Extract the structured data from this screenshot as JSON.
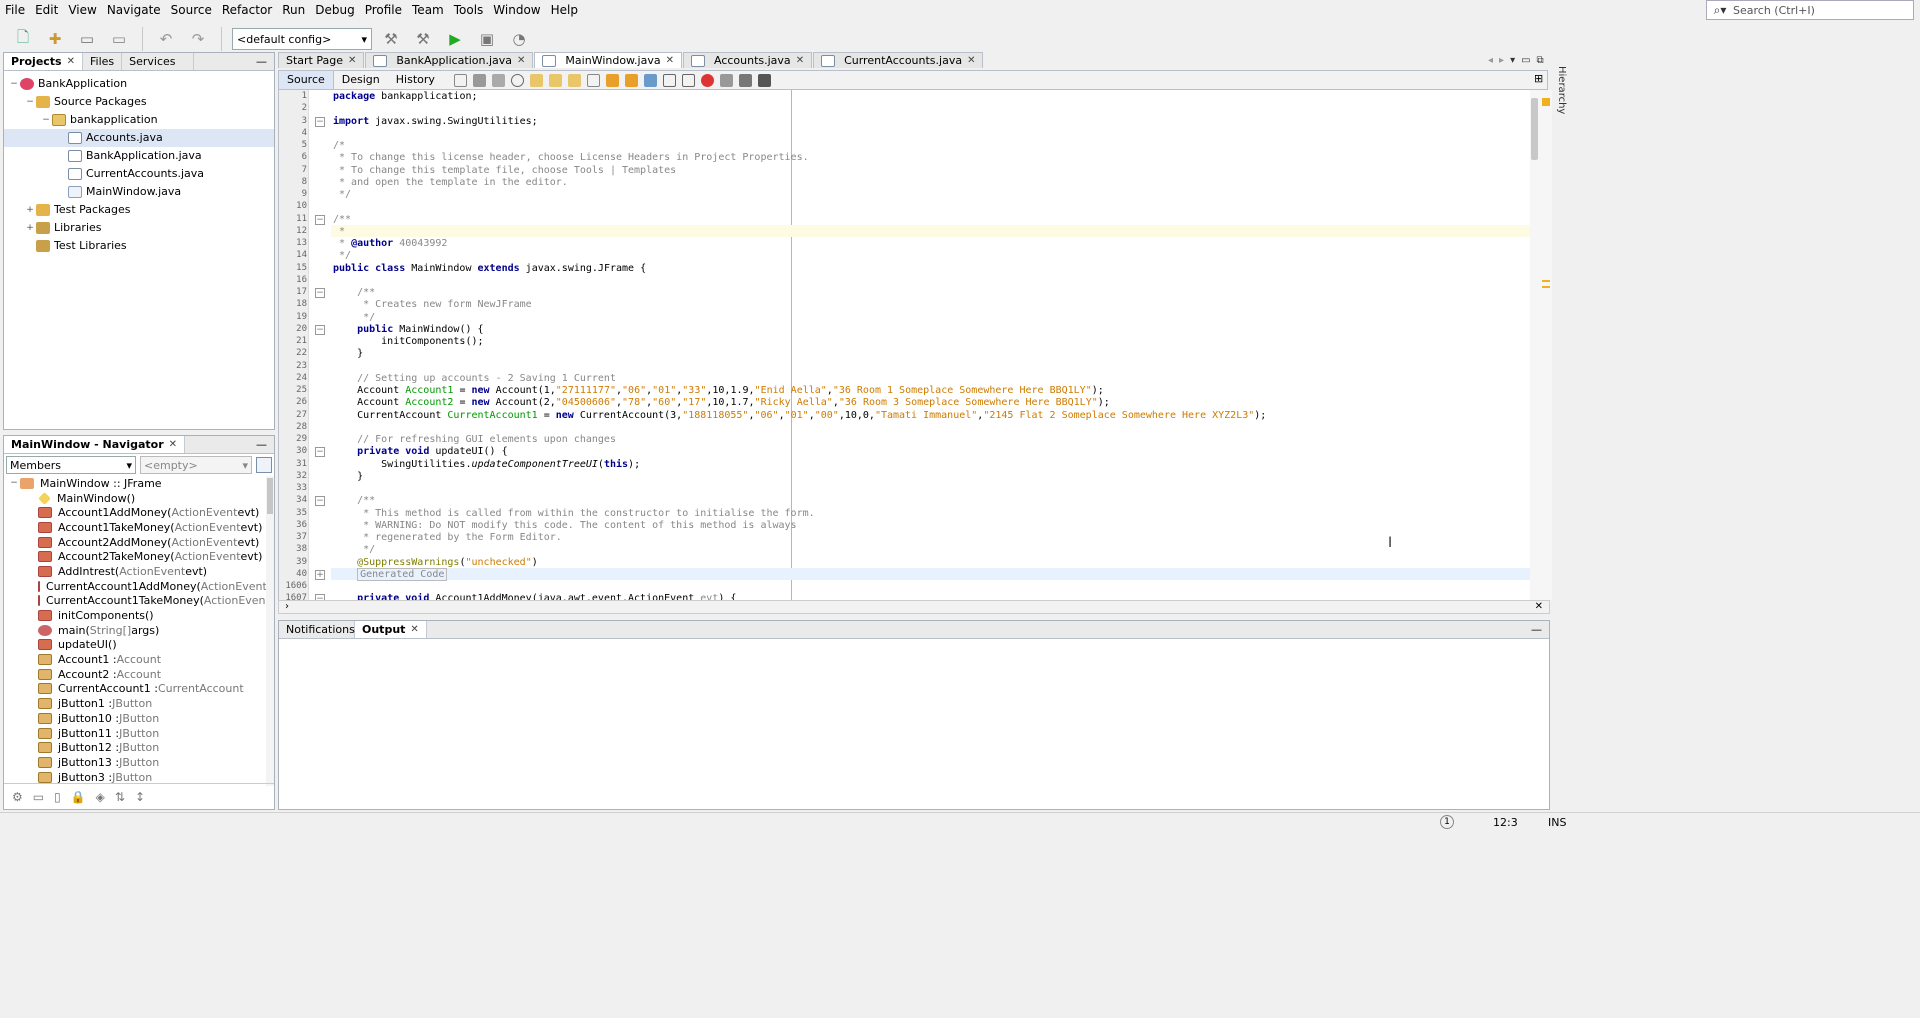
{
  "menubar": [
    "File",
    "Edit",
    "View",
    "Navigate",
    "Source",
    "Refactor",
    "Run",
    "Debug",
    "Profile",
    "Team",
    "Tools",
    "Window",
    "Help"
  ],
  "search": {
    "placeholder": "Search (Ctrl+I)",
    "icon": "search-icon"
  },
  "toolbar": {
    "config": "<default config>"
  },
  "projects": {
    "tabs": [
      "Projects",
      "Files",
      "Services"
    ],
    "tree": [
      {
        "label": "BankApplication",
        "icon": "project-icon",
        "depth": 0,
        "toggle": "−"
      },
      {
        "label": "Source Packages",
        "icon": "folder-icon",
        "depth": 1,
        "toggle": "−"
      },
      {
        "label": "bankapplication",
        "icon": "package-icon",
        "depth": 2,
        "toggle": "−"
      },
      {
        "label": "Accounts.java",
        "icon": "java-file-icon",
        "depth": 3,
        "toggle": "",
        "selected": true
      },
      {
        "label": "BankApplication.java",
        "icon": "java-file-icon",
        "depth": 3,
        "toggle": ""
      },
      {
        "label": "CurrentAccounts.java",
        "icon": "java-file-icon",
        "depth": 3,
        "toggle": ""
      },
      {
        "label": "MainWindow.java",
        "icon": "form-file-icon",
        "depth": 3,
        "toggle": ""
      },
      {
        "label": "Test Packages",
        "icon": "folder-icon",
        "depth": 1,
        "toggle": "+"
      },
      {
        "label": "Libraries",
        "icon": "library-icon",
        "depth": 1,
        "toggle": "+"
      },
      {
        "label": "Test Libraries",
        "icon": "library-icon",
        "depth": 1,
        "toggle": ""
      }
    ]
  },
  "navigator": {
    "title": "MainWindow - Navigator",
    "filter": "Members",
    "empty": "<empty>",
    "root": "MainWindow :: JFrame",
    "members": [
      {
        "name": "MainWindow()",
        "type": "",
        "kind": "constructor"
      },
      {
        "name": "Account1AddMoney(",
        "type": "ActionEvent",
        "tail": " evt)",
        "kind": "method"
      },
      {
        "name": "Account1TakeMoney(",
        "type": "ActionEvent",
        "tail": " evt)",
        "kind": "method"
      },
      {
        "name": "Account2AddMoney(",
        "type": "ActionEvent",
        "tail": " evt)",
        "kind": "method"
      },
      {
        "name": "Account2TakeMoney(",
        "type": "ActionEvent",
        "tail": " evt)",
        "kind": "method"
      },
      {
        "name": "AddIntrest(",
        "type": "ActionEvent",
        "tail": " evt)",
        "kind": "method"
      },
      {
        "name": "CurrentAccount1AddMoney(",
        "type": "ActionEvent",
        "tail": " evt)",
        "kind": "method"
      },
      {
        "name": "CurrentAccount1TakeMoney(",
        "type": "ActionEvent",
        "tail": " evt)",
        "kind": "method"
      },
      {
        "name": "initComponents()",
        "type": "",
        "tail": "",
        "kind": "method"
      },
      {
        "name": "main(",
        "type": "String[]",
        "tail": " args)",
        "kind": "static"
      },
      {
        "name": "updateUI()",
        "type": "",
        "tail": "",
        "kind": "method"
      },
      {
        "name": "Account1 : ",
        "type": "Account",
        "tail": "",
        "kind": "field"
      },
      {
        "name": "Account2 : ",
        "type": "Account",
        "tail": "",
        "kind": "field"
      },
      {
        "name": "CurrentAccount1 : ",
        "type": "CurrentAccount",
        "tail": "",
        "kind": "field"
      },
      {
        "name": "jButton1 : ",
        "type": "JButton",
        "tail": "",
        "kind": "field"
      },
      {
        "name": "jButton10 : ",
        "type": "JButton",
        "tail": "",
        "kind": "field"
      },
      {
        "name": "jButton11 : ",
        "type": "JButton",
        "tail": "",
        "kind": "field"
      },
      {
        "name": "jButton12 : ",
        "type": "JButton",
        "tail": "",
        "kind": "field"
      },
      {
        "name": "jButton13 : ",
        "type": "JButton",
        "tail": "",
        "kind": "field"
      },
      {
        "name": "jButton3 : ",
        "type": "JButton",
        "tail": "",
        "kind": "field"
      }
    ]
  },
  "editor": {
    "tabs": [
      "Start Page",
      "BankApplication.java",
      "MainWindow.java",
      "Accounts.java",
      "CurrentAccounts.java"
    ],
    "activeTab": 2,
    "modes": [
      "Source",
      "Design",
      "History"
    ],
    "lines": [
      {
        "n": "1",
        "html": "<span class='kw'>package</span> bankapplication;"
      },
      {
        "n": "2",
        "html": ""
      },
      {
        "n": "3",
        "html": "<span class='kw'>import</span> javax.swing.SwingUtilities;",
        "fold": "−"
      },
      {
        "n": "4",
        "html": ""
      },
      {
        "n": "5",
        "html": "<span class='cm'>/*</span>"
      },
      {
        "n": "6",
        "html": "<span class='cm'> * To change this license header, choose License Headers in Project Properties.</span>"
      },
      {
        "n": "7",
        "html": "<span class='cm'> * To change this template file, choose Tools | Templates</span>"
      },
      {
        "n": "8",
        "html": "<span class='cm'> * and open the template in the editor.</span>"
      },
      {
        "n": "9",
        "html": "<span class='cm'> */</span>"
      },
      {
        "n": "10",
        "html": ""
      },
      {
        "n": "11",
        "html": "<span class='cm'>/**</span>",
        "fold": "−"
      },
      {
        "n": "12",
        "html": "<span class='cm'> *</span>",
        "hl": true
      },
      {
        "n": "13",
        "html": "<span class='cm'> * </span><span class='kw'>@author</span><span class='cm'> 40043992</span>"
      },
      {
        "n": "14",
        "html": "<span class='cm'> */</span>"
      },
      {
        "n": "15",
        "html": "<span class='kw'>public class</span> MainWindow <span class='kw'>extends</span> javax.swing.JFrame {"
      },
      {
        "n": "16",
        "html": ""
      },
      {
        "n": "17",
        "html": "    <span class='cm'>/**</span>",
        "fold": "−"
      },
      {
        "n": "18",
        "html": "<span class='cm'>     * Creates new form NewJFrame</span>"
      },
      {
        "n": "19",
        "html": "<span class='cm'>     */</span>"
      },
      {
        "n": "20",
        "html": "    <span class='kw'>public</span> MainWindow() {",
        "fold": "−"
      },
      {
        "n": "21",
        "html": "        initComponents();"
      },
      {
        "n": "22",
        "html": "    }"
      },
      {
        "n": "23",
        "html": ""
      },
      {
        "n": "24",
        "html": "    <span class='cm'>// Setting up accounts - 2 Saving 1 Current</span>"
      },
      {
        "n": "25",
        "html": "    Account <span class='fld'>Account1</span> = <span class='kw'>new</span> Account(1,<span class='str'>\"27111177\"</span>,<span class='str'>\"06\"</span>,<span class='str'>\"01\"</span>,<span class='str'>\"33\"</span>,10,1.9,<span class='str'>\"Enid Aella\"</span>,<span class='str'>\"36 Room 1 Someplace Somewhere Here BBQ1LY\"</span>);"
      },
      {
        "n": "26",
        "html": "    Account <span class='fld'>Account2</span> = <span class='kw'>new</span> Account(2,<span class='str'>\"04500606\"</span>,<span class='str'>\"78\"</span>,<span class='str'>\"60\"</span>,<span class='str'>\"17\"</span>,10,1.7,<span class='str'>\"Ricky Aella\"</span>,<span class='str'>\"36 Room 3 Someplace Somewhere Here BBQ1LY\"</span>);"
      },
      {
        "n": "27",
        "html": "    CurrentAccount <span class='fld'>CurrentAccount1</span> = <span class='kw'>new</span> CurrentAccount(3,<span class='str'>\"188118055\"</span>,<span class='str'>\"06\"</span>,<span class='str'>\"01\"</span>,<span class='str'>\"00\"</span>,10,0,<span class='str'>\"Tamati Immanuel\"</span>,<span class='str'>\"2145 Flat 2 Someplace Somewhere Here XYZ2L3\"</span>);"
      },
      {
        "n": "28",
        "html": ""
      },
      {
        "n": "29",
        "html": "    <span class='cm'>// For refreshing GUI elements upon changes</span>"
      },
      {
        "n": "30",
        "html": "    <span class='kw'>private void</span> updateUI() {",
        "fold": "−"
      },
      {
        "n": "31",
        "html": "        SwingUtilities.<span class='itl'>updateComponentTreeUI</span>(<span class='kw'>this</span>);"
      },
      {
        "n": "32",
        "html": "    }"
      },
      {
        "n": "33",
        "html": ""
      },
      {
        "n": "34",
        "html": "    <span class='cm'>/**</span>",
        "fold": "−"
      },
      {
        "n": "35",
        "html": "<span class='cm'>     * This method is called from within the constructor to initialise the form.</span>"
      },
      {
        "n": "36",
        "html": "<span class='cm'>     * WARNING: Do NOT modify this code. The content of this method is always</span>"
      },
      {
        "n": "37",
        "html": "<span class='cm'>     * regenerated by the Form Editor.</span>"
      },
      {
        "n": "38",
        "html": "<span class='cm'>     */</span>"
      },
      {
        "n": "39",
        "html": "    <span class='ann'>@SuppressWarnings</span>(<span class='str'>\"unchecked\"</span>)"
      },
      {
        "n": "40",
        "html": "    <span class='cm' style='border:1px solid #bbb;padding:0 2px'>Generated Code</span>",
        "fold": "+",
        "hl2": true
      },
      {
        "n": "1606",
        "html": ""
      },
      {
        "n": "1607",
        "html": "    <span class='kw'>private void</span> Account1AddMoney(java.awt.event.ActionEvent <span class='cm'>evt</span>) {",
        "fold": "−"
      }
    ]
  },
  "output": {
    "tabs": [
      "Notifications",
      "Output"
    ]
  },
  "status": {
    "position": "12:3",
    "mode": "INS",
    "badge": "1"
  }
}
